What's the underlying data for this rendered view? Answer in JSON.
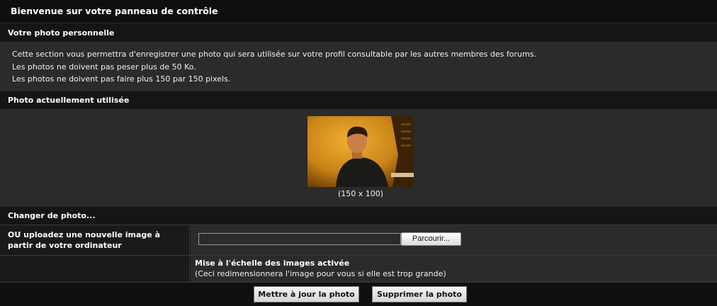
{
  "panel": {
    "title": "Bienvenue sur votre panneau de contrôle"
  },
  "personal_photo": {
    "header": "Votre photo personnelle",
    "info_lines": [
      "Cette section vous permettra d'enregistrer une photo qui sera utilisée sur votre profil consultable par les autres membres des forums.",
      "Les photos ne doivent pas peser plus de 50 Ko.",
      "Les photos ne doivent pas faire plus 150 par 150 pixels."
    ]
  },
  "current_photo": {
    "header": "Photo actuellement utilisée",
    "size_label": "(150 x 100)"
  },
  "change_photo": {
    "header": "Changer de photo...",
    "upload_label_line1": "OU uploadez une nouvelle image à",
    "upload_label_line2": "partir de votre ordinateur",
    "file_value": "",
    "browse_label": "Parcourir...",
    "scaling_title": "Mise à l'échelle des images activée",
    "scaling_note": "(Ceci redimensionnera l'image pour vous si elle est trop grande)"
  },
  "actions": {
    "update_label": "Mettre à jour la photo",
    "delete_label": "Supprimer la photo"
  }
}
